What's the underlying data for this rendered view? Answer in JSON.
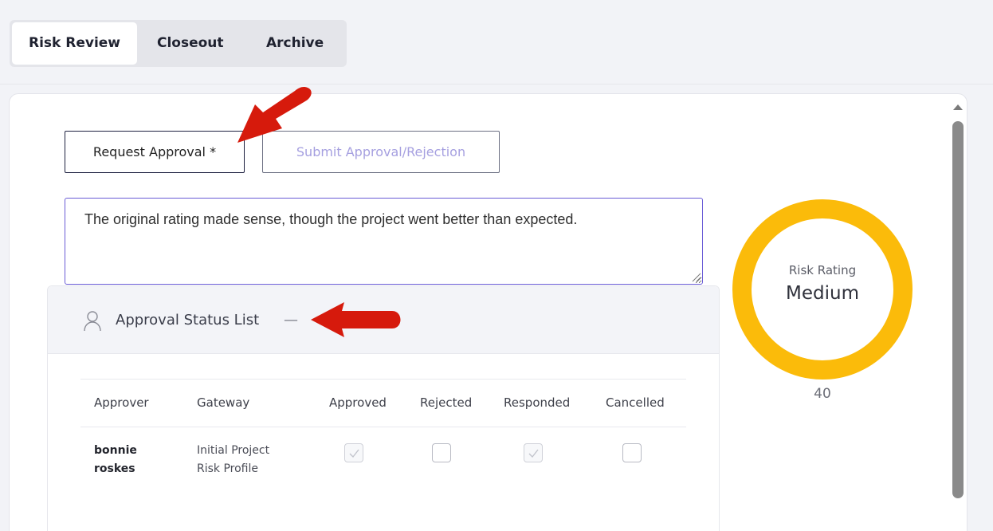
{
  "tabs": [
    {
      "label": "Risk Review",
      "active": true
    },
    {
      "label": "Closeout",
      "active": false
    },
    {
      "label": "Archive",
      "active": false
    }
  ],
  "actions": {
    "request_approval_label": "Request Approval *",
    "submit_label": "Submit Approval/Rejection"
  },
  "comment": {
    "value": "The original rating made sense, though the project went better than expected."
  },
  "approval": {
    "title": "Approval Status List",
    "collapse_glyph": "—",
    "columns": [
      "Approver",
      "Gateway",
      "Approved",
      "Rejected",
      "Responded",
      "Cancelled"
    ],
    "rows": [
      {
        "approver_line1": "bonnie",
        "approver_line2": "roskes",
        "gateway_line1": "Initial Project",
        "gateway_line2": "Risk Profile",
        "approved": true,
        "rejected": false,
        "responded": true,
        "cancelled": false
      }
    ]
  },
  "risk": {
    "label": "Risk Rating",
    "value": "Medium",
    "score": "40",
    "color": "#fbbb0a"
  },
  "annotations": {
    "arrow_color": "#d61a0c"
  },
  "icons": {
    "approver": "person-icon",
    "check": "checkmark-icon"
  }
}
